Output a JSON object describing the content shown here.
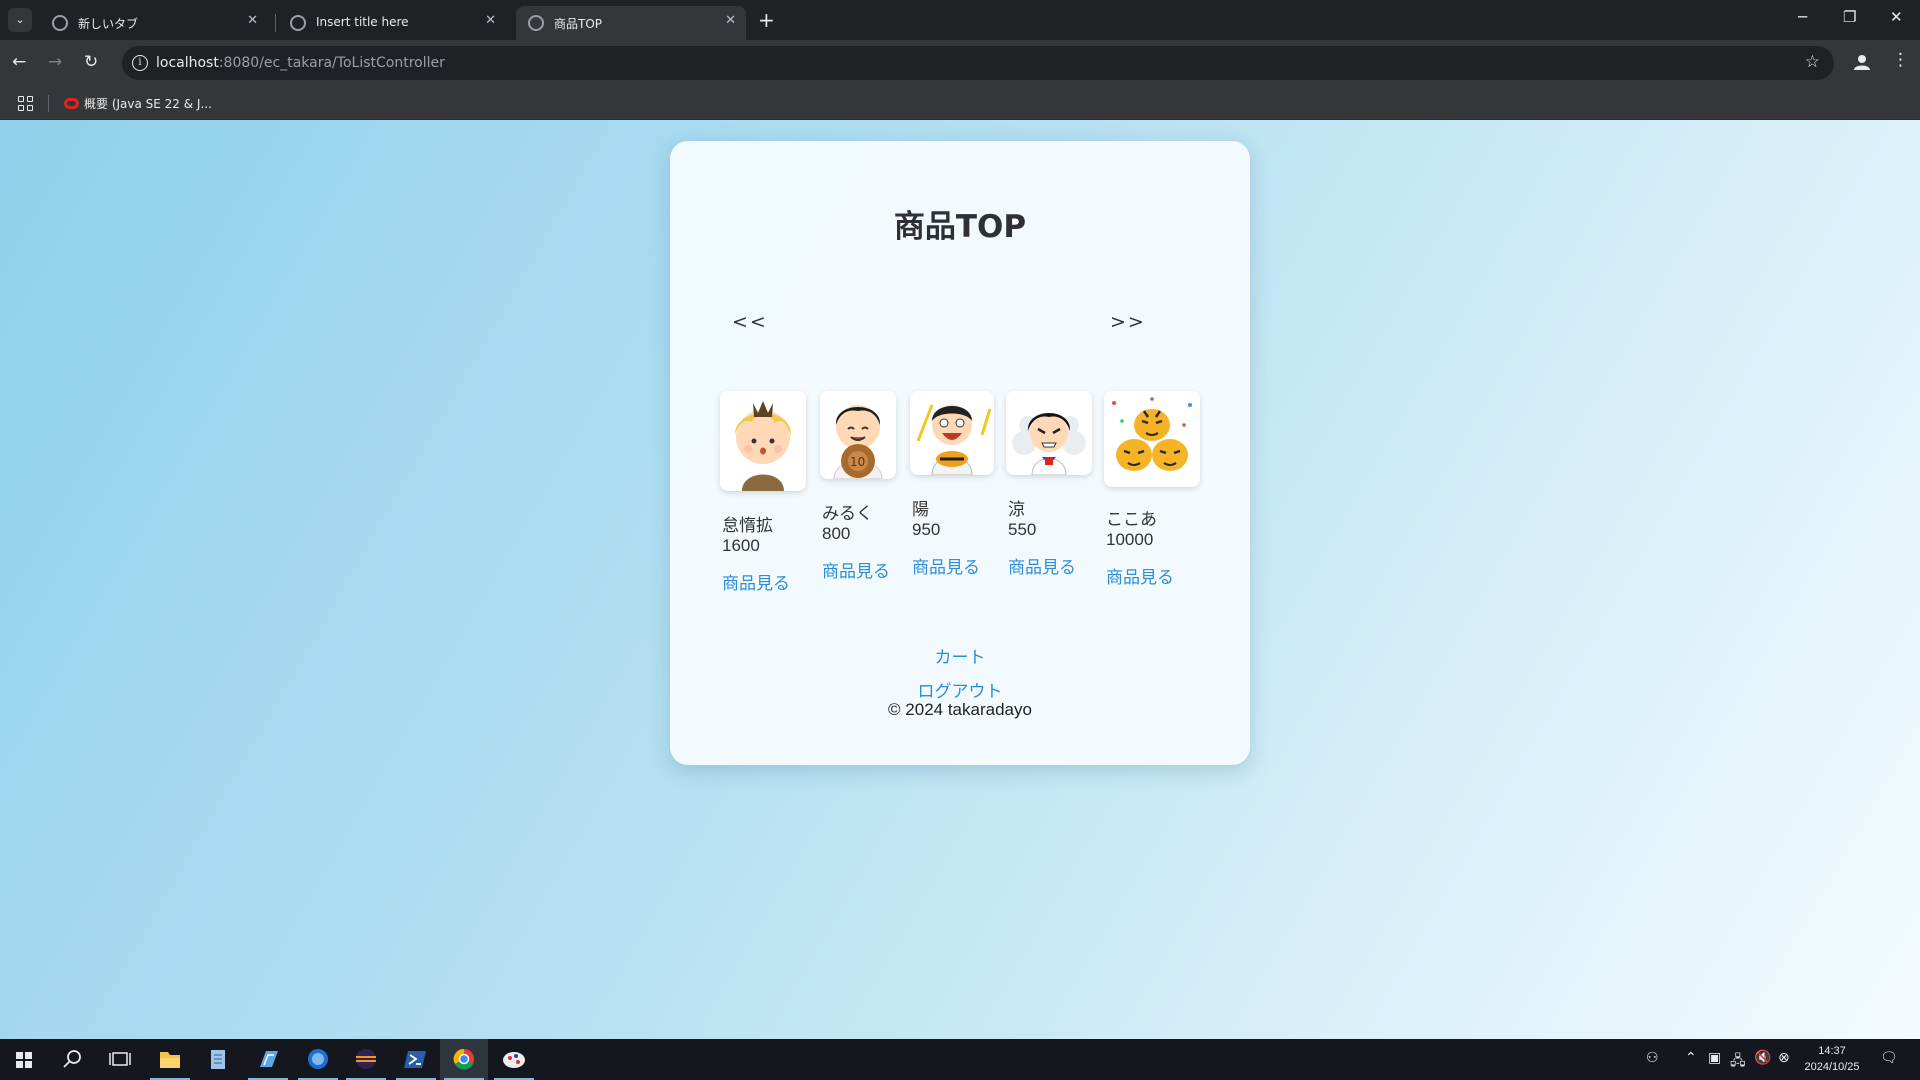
{
  "browser": {
    "tabs": [
      {
        "title": "新しいタブ",
        "active": false
      },
      {
        "title": "Insert title here",
        "active": false
      },
      {
        "title": "商品TOP",
        "active": true
      }
    ],
    "url_host": "localhost",
    "url_rest": ":8080/ec_takara/ToListController",
    "bookmarks": [
      {
        "label": "概要 (Java SE 22 & J..."
      }
    ]
  },
  "page": {
    "title": "商品TOP",
    "prev_label": "<<",
    "next_label": ">>",
    "products": [
      {
        "name": "怠惰拡",
        "price": "1600",
        "link": "商品見る",
        "icon": "blond-boy-illustration"
      },
      {
        "name": "みるく",
        "price": "800",
        "link": "商品見る",
        "icon": "baseball-boy-illustration"
      },
      {
        "name": "陽",
        "price": "950",
        "link": "商品見る",
        "icon": "fan-cheering-illustration"
      },
      {
        "name": "涼",
        "price": "550",
        "link": "商品見る",
        "icon": "angry-cook-illustration"
      },
      {
        "name": "ここあ",
        "price": "10000",
        "link": "商品見る",
        "icon": "tigers-illustration"
      }
    ],
    "cart_label": "カート",
    "logout_label": "ログアウト",
    "copyright": "© 2024 takaradayo"
  },
  "taskbar": {
    "time": "14:37",
    "date": "2024/10/25"
  },
  "colors": {
    "link": "#2b8ed8",
    "background_gradient_start": "#8fd0ec",
    "background_gradient_end": "#f4fbfe"
  }
}
